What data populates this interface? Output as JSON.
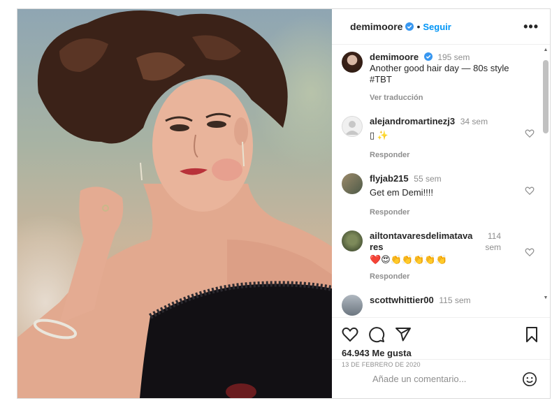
{
  "post": {
    "author": "demimoore",
    "follow_label": "Seguir",
    "separator": "•",
    "more_label": "•••",
    "caption": {
      "author": "demimoore",
      "time": "195 sem",
      "line1": "Another good hair day — 80s style",
      "line2": "#TBT",
      "translate_label": "Ver traducción"
    },
    "comments": [
      {
        "user": "alejandromartinezj3",
        "time": "34 sem",
        "text": "▯ ✨",
        "reply": "Responder"
      },
      {
        "user": "flyjab215",
        "time": "55 sem",
        "text": "Get em Demi!!!!",
        "reply": "Responder"
      },
      {
        "user": "ailtontavaresdelimatavares",
        "time": "114 sem",
        "text": "❤️😍👏👏👏👏👏",
        "reply": "Responder"
      },
      {
        "user": "scottwhittier00",
        "time": "115 sem",
        "text": "",
        "reply": ""
      }
    ],
    "likes": "64.943 Me gusta",
    "date": "13 DE FEBRERO DE 2020",
    "comment_placeholder": "Añade un comentario..."
  },
  "colors": {
    "accent": "#0095f6",
    "verified": "#3897f0",
    "muted": "#8e8e8e"
  },
  "icons": [
    "verified-badge-icon",
    "more-icon",
    "heart-icon",
    "comment-icon",
    "share-icon",
    "save-icon",
    "emoji-icon"
  ]
}
